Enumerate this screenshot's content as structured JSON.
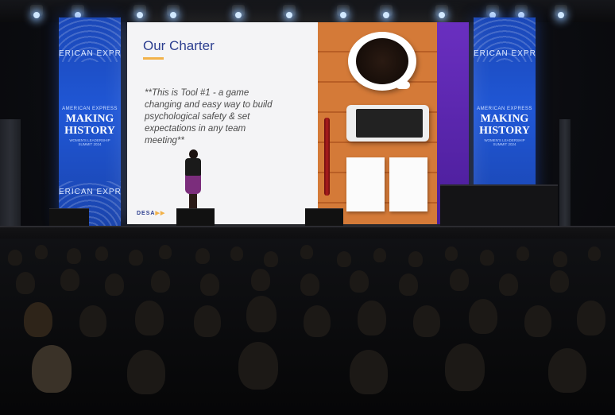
{
  "slide": {
    "title": "Our Charter",
    "quote": "**This is Tool #1 - a game changing and easy way to build psychological safety & set expectations in any team meeting**",
    "logo": "DESA",
    "logo_mark": "▶▶"
  },
  "banners": {
    "left": {
      "brand": "ERICAN EXPRE",
      "subtitle": "AMERICAN EXPRESS",
      "headline_1": "MAKING",
      "headline_2": "HISTORY",
      "tagline": "WOMEN'S LEADERSHIP SUMMIT 2024"
    },
    "right": {
      "brand": "ERICAN EXPRE",
      "subtitle": "AMERICAN EXPRESS",
      "headline_1": "MAKING",
      "headline_2": "HISTORY",
      "tagline": "WOMEN'S LEADERSHIP SUMMIT 2024"
    }
  },
  "colors": {
    "banner_blue": "#2057d6",
    "slide_title": "#2c3e8f",
    "accent_orange": "#f2b24a",
    "speaker_dress": "#7b2d7c",
    "slide_purple": "#6a2fc0"
  }
}
